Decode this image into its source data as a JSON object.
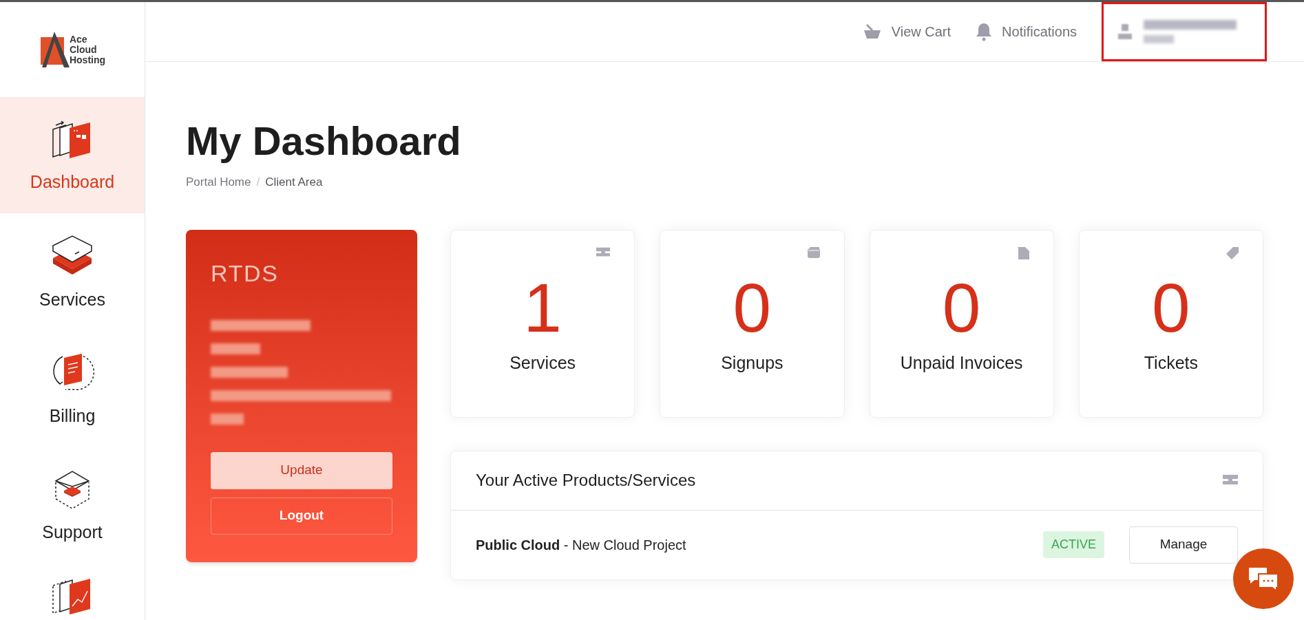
{
  "logo": {
    "lines": [
      "Ace",
      "Cloud",
      "Hosting"
    ]
  },
  "sidebar": {
    "items": [
      {
        "label": "Dashboard",
        "kind": "dashboard",
        "selected": true
      },
      {
        "label": "Services",
        "kind": "services",
        "selected": false
      },
      {
        "label": "Billing",
        "kind": "billing",
        "selected": false
      },
      {
        "label": "Support",
        "kind": "support",
        "selected": false
      },
      {
        "kind": "reports",
        "selected": false
      }
    ]
  },
  "header": {
    "links": [
      {
        "label": "View Cart",
        "kind": "cart"
      },
      {
        "label": "Notifications",
        "kind": "bell"
      }
    ]
  },
  "page": {
    "title": "My Dashboard",
    "breadcrumb": [
      "Portal Home",
      "Client Area"
    ],
    "breadcrumb_separator": "/"
  },
  "account_card": {
    "company": "RTDS",
    "buttons": [
      {
        "label": "Update",
        "kind": "primary"
      },
      {
        "label": "Logout",
        "kind": "outline"
      }
    ]
  },
  "stats": [
    {
      "value": "1",
      "label": "Services",
      "kind": "server"
    },
    {
      "value": "0",
      "label": "Signups",
      "kind": "wallet"
    },
    {
      "value": "0",
      "label": "Unpaid Invoices",
      "kind": "file"
    },
    {
      "value": "0",
      "label": "Tickets",
      "kind": "tag"
    }
  ],
  "products_panel": {
    "title": "Your Active Products/Services",
    "rows": [
      {
        "product": "**Public Cloud** - New Cloud Project",
        "status": "ACTIVE",
        "action": "Manage"
      }
    ]
  }
}
